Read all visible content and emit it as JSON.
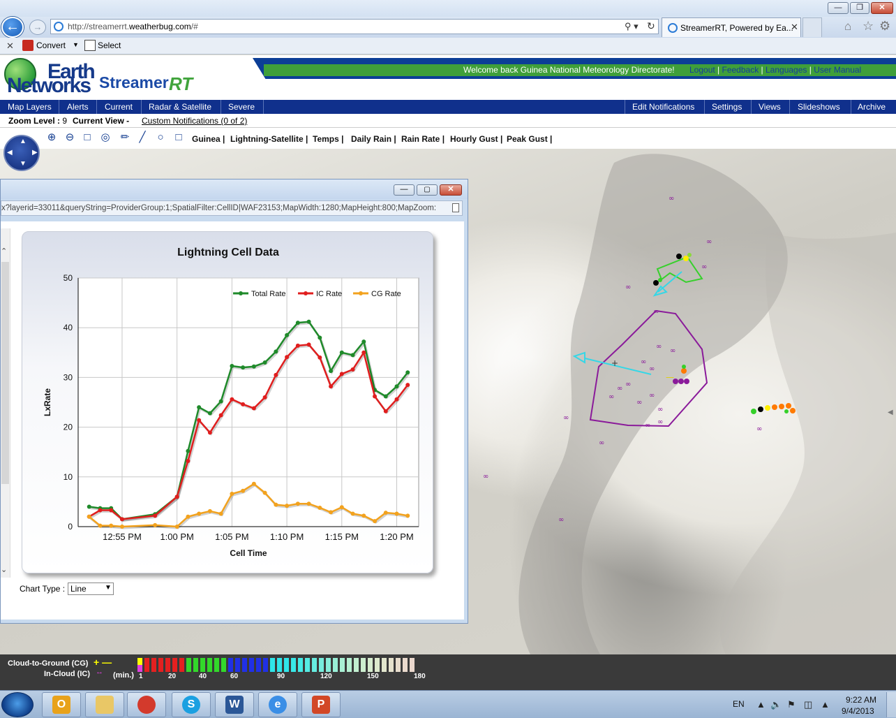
{
  "browser": {
    "url_prefix": "http://streamerrt.",
    "url_domain": "weatherbug.com",
    "url_suffix": "/#",
    "tab_title": "StreamerRT, Powered by Ea...",
    "command_bar": {
      "convert": "Convert",
      "select": "Select"
    }
  },
  "site": {
    "logo_line1": "Earth",
    "logo_line2": "Networks",
    "product": "Streamer",
    "product_suffix": "RT",
    "welcome": "Welcome back  Guinea National Meteorology Directorate!",
    "user_links": [
      "Logout",
      "Feedback",
      "Languages",
      "User Manual"
    ]
  },
  "main_nav": {
    "left": [
      "Map Layers",
      "Alerts",
      "Current",
      "Radar & Satellite",
      "Severe"
    ],
    "right": [
      "Edit Notifications",
      "Settings",
      "Views",
      "Slideshows",
      "Archive"
    ]
  },
  "status": {
    "zoom_label": "Zoom Level :",
    "zoom_value": "9",
    "current_view_label": "Current View -",
    "custom_notifications": "Custom Notifications (0 of 2)"
  },
  "layers": [
    "Guinea",
    "Lightning-Satellite",
    "Temps",
    "Daily Rain",
    "Rain Rate",
    "Hourly Gust",
    "Peak Gust"
  ],
  "popup": {
    "url": "x?layerid=33011&queryString=ProviderGroup:1;SpatialFilter:CellID|WAF23153;MapWidth:1280;MapHeight:800;MapZoom:",
    "chart_type_label": "Chart Type :",
    "chart_type_value": "Line"
  },
  "chart_data": {
    "type": "line",
    "title": "Lightning Cell Data",
    "xlabel": "Cell Time",
    "ylabel": "LxRate",
    "ylim": [
      0,
      50
    ],
    "yticks": [
      0,
      10,
      20,
      30,
      40,
      50
    ],
    "xtick_labels": [
      "12:55 PM",
      "1:00 PM",
      "1:05 PM",
      "1:10 PM",
      "1:15 PM",
      "1:20 PM"
    ],
    "xtick_minutes": [
      -5,
      0,
      5,
      10,
      15,
      20
    ],
    "xlim_minutes": [
      -9,
      22
    ],
    "legend_position": "top-right",
    "grid": true,
    "series": [
      {
        "name": "Total Rate",
        "color": "#1f8a2a",
        "x": [
          -8,
          -7,
          -6,
          -5,
          -2,
          0,
          1,
          2,
          3,
          4,
          5,
          6,
          7,
          8,
          9,
          10,
          11,
          12,
          13,
          14,
          15,
          16,
          17,
          18,
          19,
          20,
          21
        ],
        "y": [
          4,
          3.7,
          3.7,
          1.5,
          2.5,
          6,
          15.2,
          24,
          22.8,
          25.2,
          32.3,
          32,
          32.2,
          33,
          35.2,
          38.5,
          41,
          41.2,
          38,
          31.3,
          35,
          34.5,
          37.2,
          27.5,
          26.2,
          28.2,
          31
        ]
      },
      {
        "name": "IC Rate",
        "color": "#e01e1e",
        "x": [
          -8,
          -7,
          -6,
          -5,
          -2,
          0,
          1,
          2,
          3,
          4,
          5,
          6,
          7,
          8,
          9,
          10,
          11,
          12,
          13,
          14,
          15,
          16,
          17,
          18,
          19,
          20,
          21
        ],
        "y": [
          2,
          3.3,
          3.3,
          1.5,
          2.2,
          6,
          13.2,
          21.4,
          18.9,
          22.4,
          25.6,
          24.6,
          23.8,
          26,
          30.5,
          34.1,
          36.4,
          36.6,
          34,
          28.2,
          30.7,
          31.6,
          35,
          26.2,
          23.2,
          25.6,
          28.5
        ]
      },
      {
        "name": "CG Rate",
        "color": "#f2a21e",
        "x": [
          -8,
          -7,
          -6,
          -5,
          -2,
          0,
          1,
          2,
          3,
          4,
          5,
          6,
          7,
          8,
          9,
          10,
          11,
          12,
          13,
          14,
          15,
          16,
          17,
          18,
          19,
          20,
          21
        ],
        "y": [
          2,
          0.2,
          0.2,
          0,
          0.3,
          0,
          2,
          2.6,
          3.1,
          2.6,
          6.6,
          7.2,
          8.6,
          6.8,
          4.4,
          4.2,
          4.6,
          4.6,
          3.8,
          2.9,
          3.9,
          2.6,
          2.2,
          1.1,
          2.8,
          2.6,
          2.2
        ]
      }
    ]
  },
  "legend": {
    "cg_label": "Cloud-to-Ground (CG)",
    "ic_label": "In-Cloud (IC)",
    "minutes_label": "(min.)",
    "minute_ticks": [
      "1",
      "20",
      "40",
      "60",
      "90",
      "120",
      "150",
      "180"
    ],
    "cg_symbol": "+ —",
    "ic_symbol": "↔"
  },
  "taskbar": {
    "lang": "EN",
    "time": "9:22 AM",
    "date": "9/4/2013"
  }
}
